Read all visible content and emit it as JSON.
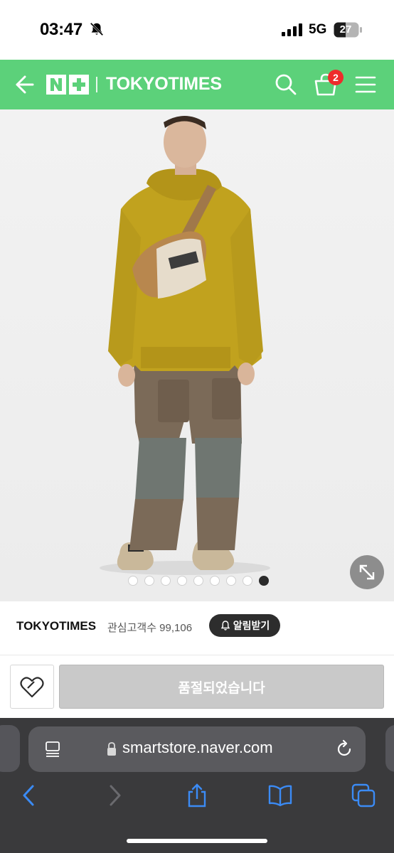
{
  "status_bar": {
    "time": "03:47",
    "network": "5G",
    "battery": "27"
  },
  "header": {
    "logo": "N+",
    "store_name": "TOKYOTIMES",
    "cart_count": "2",
    "brand_color": "#5cd17a"
  },
  "gallery": {
    "image_count": 9,
    "active_index": 8
  },
  "store_info": {
    "name": "TOKYOTIMES",
    "interest_text": "관심고객수 99,106",
    "alarm_label": "알림받기"
  },
  "purchase": {
    "status_label": "품절되었습니다"
  },
  "browser": {
    "url": "smartstore.naver.com"
  }
}
